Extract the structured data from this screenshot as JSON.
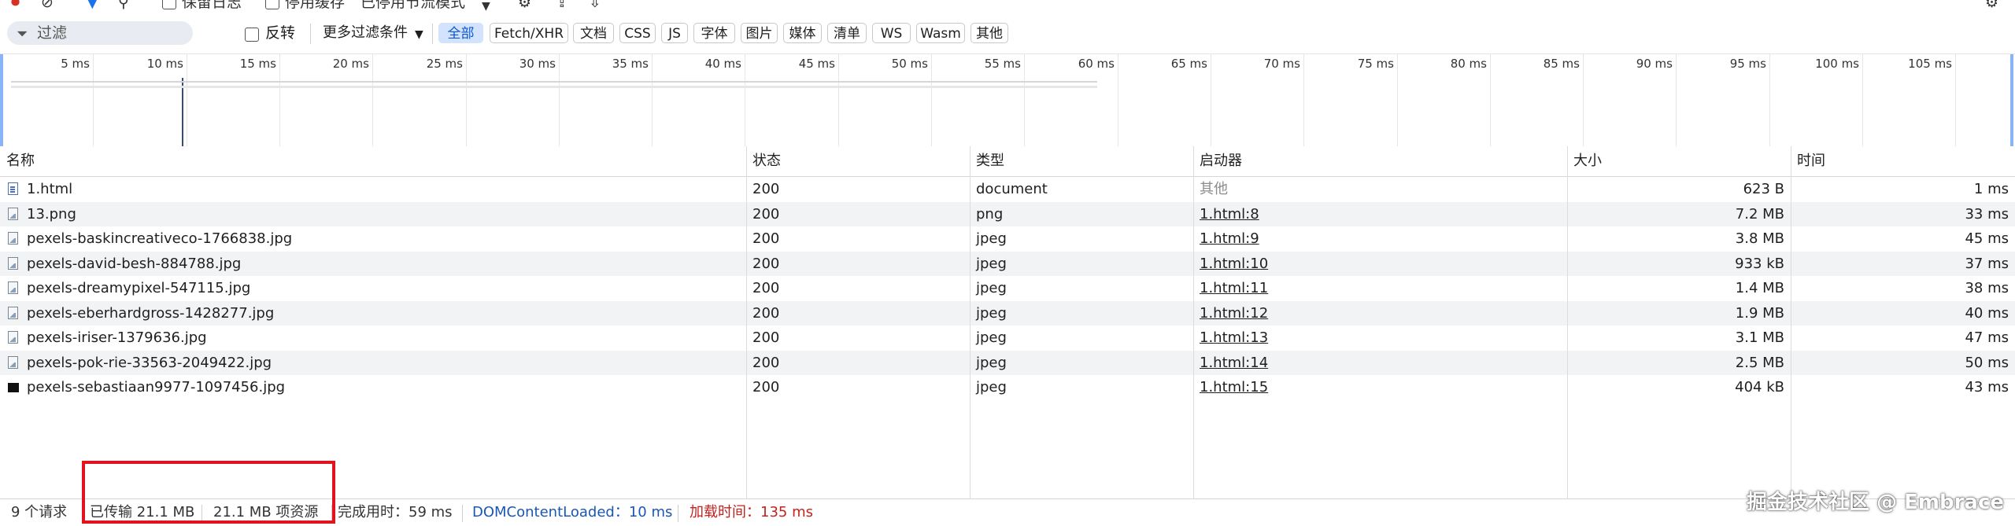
{
  "toolbar": {
    "preserve_log": "保留日志",
    "disable_cache": "停用缓存",
    "throttle": "已停用节流模式"
  },
  "filter": {
    "placeholder": "过滤",
    "invert": "反转",
    "more_filters": "更多过滤条件",
    "types": [
      "全部",
      "Fetch/XHR",
      "文档",
      "CSS",
      "JS",
      "字体",
      "图片",
      "媒体",
      "清单",
      "WS",
      "Wasm",
      "其他"
    ],
    "active_type": "全部"
  },
  "timeline": {
    "ticks": [
      "5 ms",
      "10 ms",
      "15 ms",
      "20 ms",
      "25 ms",
      "30 ms",
      "35 ms",
      "40 ms",
      "45 ms",
      "50 ms",
      "55 ms",
      "60 ms",
      "65 ms",
      "70 ms",
      "75 ms",
      "80 ms",
      "85 ms",
      "90 ms",
      "95 ms",
      "100 ms",
      "105 ms"
    ]
  },
  "table": {
    "columns": [
      "名称",
      "状态",
      "类型",
      "启动器",
      "大小",
      "时间"
    ],
    "rows": [
      {
        "name": "1.html",
        "status": "200",
        "type": "document",
        "initiator": "其他",
        "size": "623 B",
        "time": "1 ms",
        "icon": "document-icon"
      },
      {
        "name": "13.png",
        "status": "200",
        "type": "png",
        "initiator": "1.html:8",
        "size": "7.2 MB",
        "time": "33 ms",
        "icon": "image-icon"
      },
      {
        "name": "pexels-baskincreativeco-1766838.jpg",
        "status": "200",
        "type": "jpeg",
        "initiator": "1.html:9",
        "size": "3.8 MB",
        "time": "45 ms",
        "icon": "image-icon"
      },
      {
        "name": "pexels-david-besh-884788.jpg",
        "status": "200",
        "type": "jpeg",
        "initiator": "1.html:10",
        "size": "933 kB",
        "time": "37 ms",
        "icon": "image-icon"
      },
      {
        "name": "pexels-dreamypixel-547115.jpg",
        "status": "200",
        "type": "jpeg",
        "initiator": "1.html:11",
        "size": "1.4 MB",
        "time": "38 ms",
        "icon": "image-icon"
      },
      {
        "name": "pexels-eberhardgross-1428277.jpg",
        "status": "200",
        "type": "jpeg",
        "initiator": "1.html:12",
        "size": "1.9 MB",
        "time": "40 ms",
        "icon": "image-icon"
      },
      {
        "name": "pexels-iriser-1379636.jpg",
        "status": "200",
        "type": "jpeg",
        "initiator": "1.html:13",
        "size": "3.1 MB",
        "time": "47 ms",
        "icon": "image-icon"
      },
      {
        "name": "pexels-pok-rie-33563-2049422.jpg",
        "status": "200",
        "type": "jpeg",
        "initiator": "1.html:14",
        "size": "2.5 MB",
        "time": "50 ms",
        "icon": "image-icon"
      },
      {
        "name": "pexels-sebastiaan9977-1097456.jpg",
        "status": "200",
        "type": "jpeg",
        "initiator": "1.html:15",
        "size": "404 kB",
        "time": "43 ms",
        "icon": "dark-image-icon"
      }
    ]
  },
  "status_bar": {
    "requests": "9 个请求",
    "transferred": "已传输 21.1 MB",
    "resources": "21.1 MB 项资源",
    "finish": "完成用时：59 ms",
    "dom_loaded": "DOMContentLoaded：10 ms",
    "load": "加载时间：135 ms"
  },
  "colors": {
    "dom_loaded": "#1a56b8",
    "load": "#c5221f",
    "highlight": "#e0131e",
    "active_chip_bg": "#d3e3fd"
  },
  "watermark": "掘金技术社区 @ Embrace"
}
